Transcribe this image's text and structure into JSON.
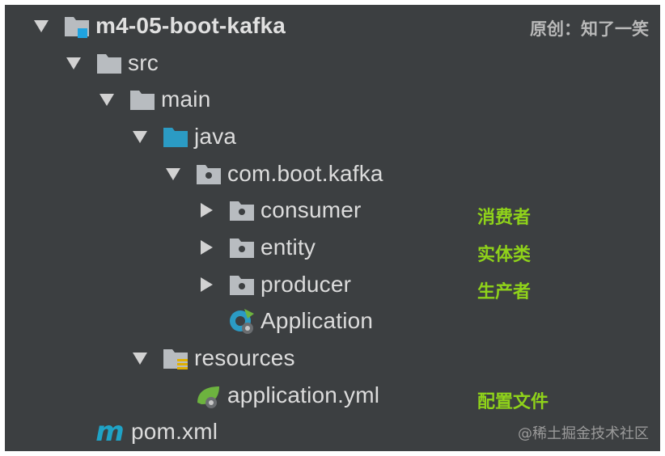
{
  "watermark": {
    "top": "原创：知了一笑",
    "bottom": "@稀土掘金技术社区"
  },
  "tree": {
    "root": "m4-05-boot-kafka",
    "src": "src",
    "main": "main",
    "java": "java",
    "package": "com.boot.kafka",
    "consumer": "consumer",
    "entity": "entity",
    "producer": "producer",
    "application": "Application",
    "resources": "resources",
    "yml": "application.yml",
    "pom": "pom.xml"
  },
  "notes": {
    "consumer": "消费者",
    "entity": "实体类",
    "producer": "生产者",
    "config": "配置文件"
  },
  "colors": {
    "background": "#3c3f41",
    "text": "#dcdcdc",
    "annotation": "#8fd21a",
    "folder": "#b8bcc0",
    "source_folder": "#2b9bc4",
    "spring_green": "#6db33f"
  }
}
